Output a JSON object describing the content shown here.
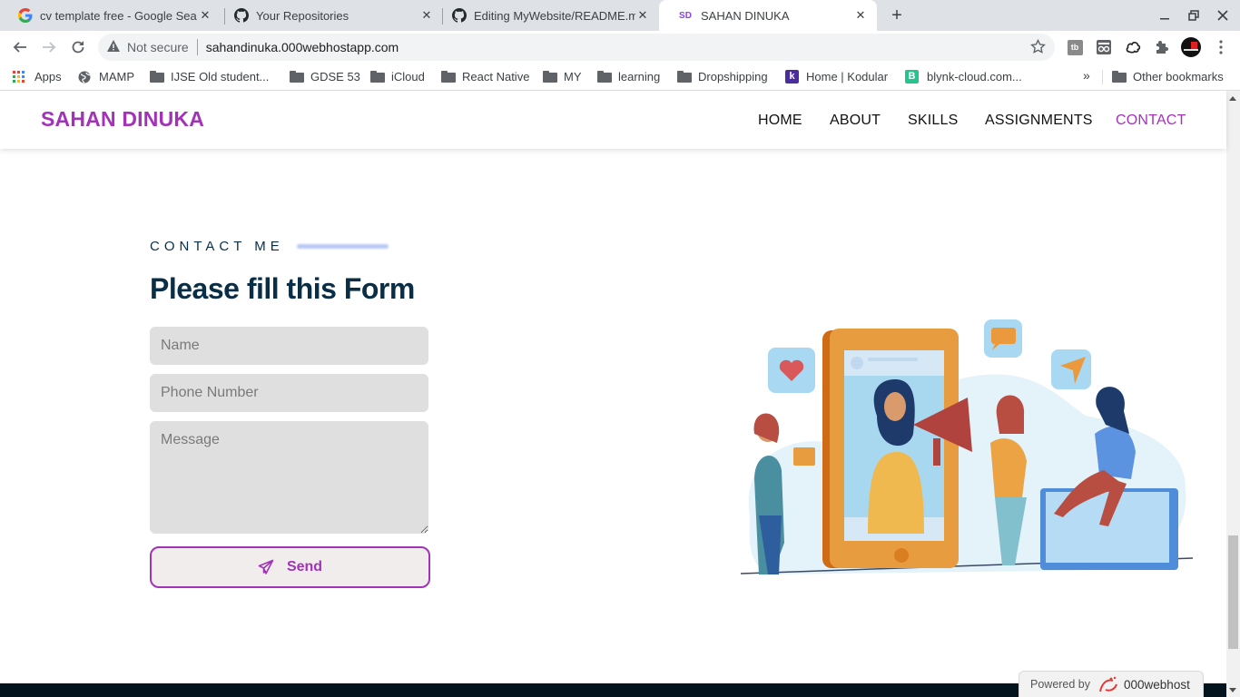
{
  "browser": {
    "tabs": [
      {
        "title": "cv template free - Google Sea",
        "favicon": "google-icon",
        "active": false
      },
      {
        "title": "Your Repositories",
        "favicon": "github-icon",
        "active": false
      },
      {
        "title": "Editing MyWebsite/README.m",
        "favicon": "github-icon",
        "active": false
      },
      {
        "title": "SAHAN DINUKA",
        "favicon": "SD",
        "active": true
      }
    ],
    "new_tab": "+",
    "security_label": "Not secure",
    "url": "sahandinuka.000webhostapp.com",
    "bookmarks": [
      {
        "label": "Apps",
        "icon": "apps-grid-icon"
      },
      {
        "label": "MAMP",
        "icon": "globe-icon"
      },
      {
        "label": "IJSE Old student...",
        "icon": "folder-icon"
      },
      {
        "label": "GDSE 53",
        "icon": "folder-icon"
      },
      {
        "label": "iCloud",
        "icon": "folder-icon"
      },
      {
        "label": "React Native",
        "icon": "folder-icon"
      },
      {
        "label": "MY",
        "icon": "folder-icon"
      },
      {
        "label": "learning",
        "icon": "folder-icon"
      },
      {
        "label": "Dropshipping",
        "icon": "folder-icon"
      },
      {
        "label": "Home | Kodular",
        "icon": "kodular-icon"
      },
      {
        "label": "blynk-cloud.com...",
        "icon": "blynk-icon"
      }
    ],
    "bookmarks_overflow": "»",
    "other_bookmarks": "Other bookmarks"
  },
  "site": {
    "brand": "SAHAN DINUKA",
    "nav": [
      {
        "label": "HOME",
        "active": false
      },
      {
        "label": "ABOUT",
        "active": false
      },
      {
        "label": "SKILLS",
        "active": false
      },
      {
        "label": "ASSIGNMENTS",
        "active": false
      },
      {
        "label": "CONTACT",
        "active": true
      }
    ],
    "colors": {
      "accent": "#a233b8",
      "heading": "#0b2e47",
      "footer": "#03141f"
    }
  },
  "contact": {
    "kicker": "CONTACT ME",
    "heading": "Please fill this Form",
    "fields": {
      "name": {
        "placeholder": "Name",
        "value": ""
      },
      "phone": {
        "placeholder": "Phone Number",
        "value": ""
      },
      "message": {
        "placeholder": "Message",
        "value": ""
      }
    },
    "send_label": "Send"
  },
  "powered_by": {
    "prefix": "Powered by",
    "brand": "000webhost"
  }
}
